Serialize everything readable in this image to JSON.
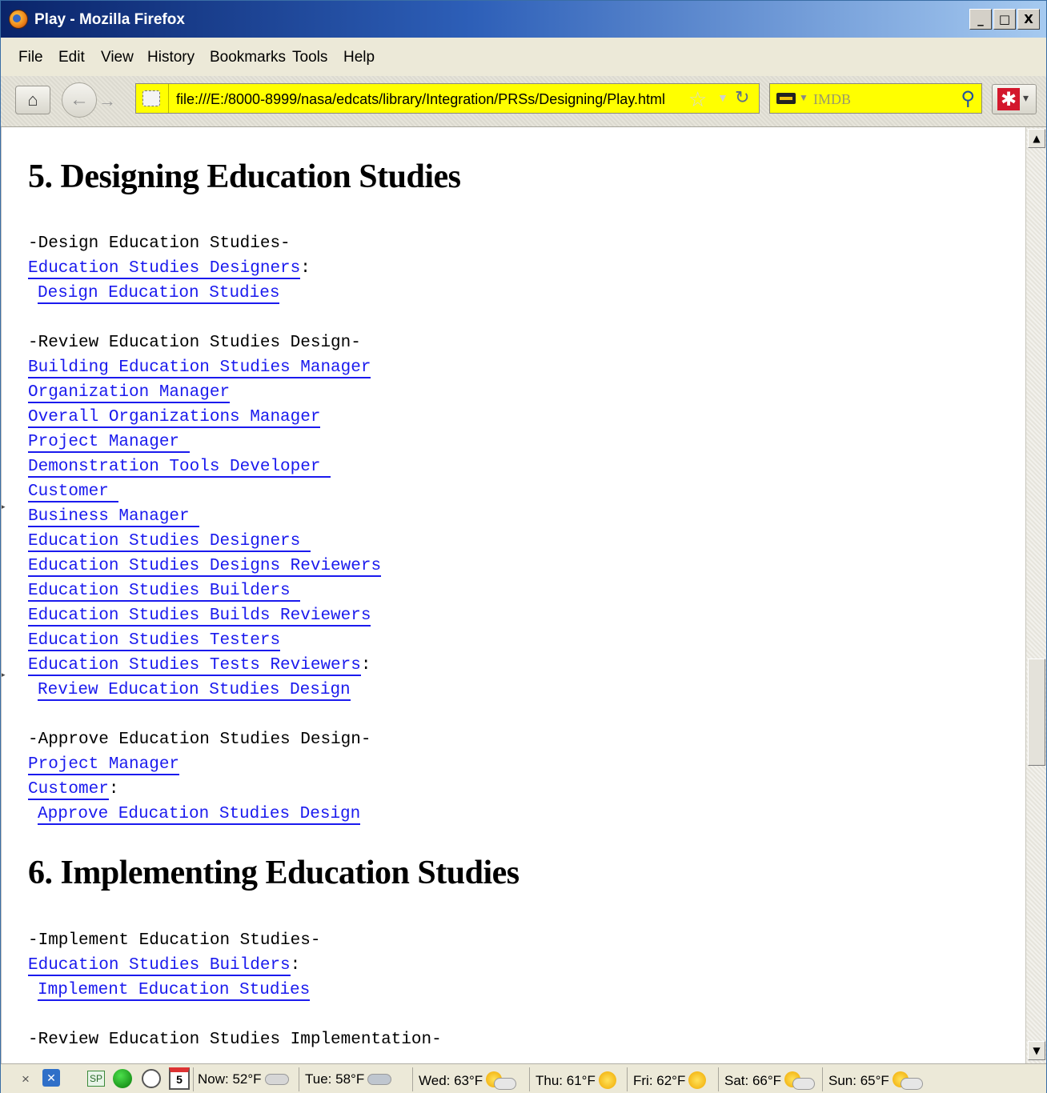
{
  "window": {
    "title": "Play - Mozilla Firefox",
    "controls": [
      "_",
      "□",
      "X"
    ]
  },
  "menu": [
    "File",
    "Edit",
    "View",
    "History",
    "Bookmarks",
    "Tools",
    "Help"
  ],
  "toolbar": {
    "url": "file:///E:/8000-8999/nasa/edcats/library/Integration/PRSs/Designing/Play.html",
    "search_placeholder": "IMDB",
    "home_icon": "home-icon",
    "accent_urlbar": "#ffff00"
  },
  "content": {
    "section5": {
      "heading": "5. Designing Education Studies",
      "block1": {
        "title": "-Design Education Studies-",
        "role": "Education Studies Designers",
        "colon": ":",
        "action": "Design Education Studies"
      },
      "block2": {
        "title": "-Review Education Studies Design-",
        "roles": [
          "Building Education Studies Manager",
          "Organization Manager",
          "Overall Organizations Manager",
          "Project Manager ",
          "Demonstration Tools Developer ",
          "Customer ",
          "Business Manager ",
          "Education Studies Designers ",
          "Education Studies Designs Reviewers",
          "Education Studies Builders ",
          "Education Studies Builds Reviewers",
          "Education Studies Testers",
          "Education Studies Tests Reviewers"
        ],
        "colon": ":",
        "action": "Review Education Studies Design"
      },
      "block3": {
        "title": "-Approve Education Studies Design-",
        "roles": [
          "Project Manager",
          "Customer"
        ],
        "colon": ":",
        "action": "Approve Education Studies Design"
      }
    },
    "section6": {
      "heading": "6. Implementing Education Studies",
      "block1": {
        "title": "-Implement Education Studies-",
        "role": "Education Studies Builders",
        "colon": ":",
        "action": "Implement Education Studies"
      },
      "block2_title": "-Review Education Studies Implementation-"
    }
  },
  "statusbar": {
    "close": "×",
    "calendar_day": "5",
    "sp_label": "SP",
    "weather": [
      {
        "label": "Now: 52°F",
        "icon": "cloud"
      },
      {
        "label": "Tue: 58°F",
        "icon": "rain-cloud"
      },
      {
        "label": "Wed: 63°F",
        "icon": "sun-cloud"
      },
      {
        "label": "Thu: 61°F",
        "icon": "sun"
      },
      {
        "label": "Fri: 62°F",
        "icon": "sun"
      },
      {
        "label": "Sat: 66°F",
        "icon": "sun-cloud"
      },
      {
        "label": "Sun: 65°F",
        "icon": "sun-cloud"
      }
    ]
  }
}
